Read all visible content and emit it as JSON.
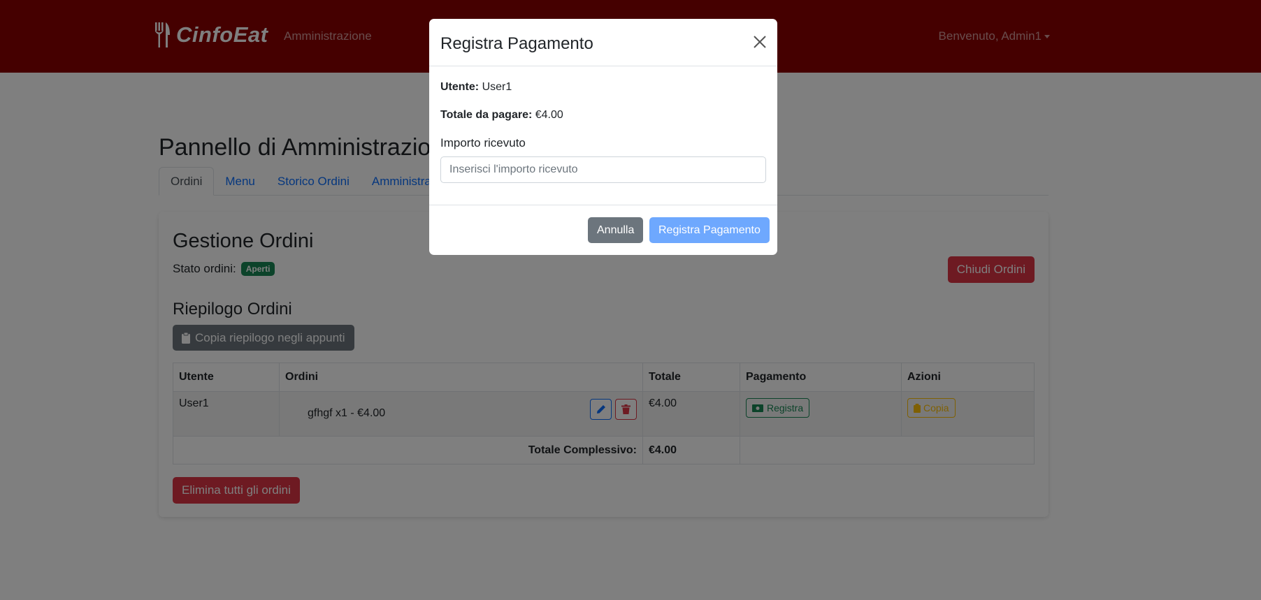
{
  "navbar": {
    "brand": "CinfoEat",
    "admin_link": "Amministrazione",
    "user_menu": "Benvenuto, Admin1"
  },
  "page": {
    "title": "Pannello di Amministrazione",
    "tabs": [
      {
        "label": "Ordini",
        "active": true
      },
      {
        "label": "Menu",
        "active": false
      },
      {
        "label": "Storico Ordini",
        "active": false
      },
      {
        "label": "Amministrat",
        "active": false
      }
    ]
  },
  "orders": {
    "title": "Gestione Ordini",
    "status_label": "Stato ordini:",
    "status_badge": "Aperti",
    "close_button": "Chiudi Ordini",
    "summary_title": "Riepilogo Ordini",
    "copy_summary_button": "Copia riepilogo negli appunti",
    "table": {
      "headers": [
        "Utente",
        "Ordini",
        "Totale",
        "Pagamento",
        "Azioni"
      ],
      "rows": [
        {
          "user": "User1",
          "order": "gfhgf x1 - €4.00",
          "total": "€4.00",
          "payment_button": "Registra",
          "action_button": "Copia"
        }
      ],
      "grand_total_label": "Totale Complessivo:",
      "grand_total_value": "€4.00"
    },
    "delete_all_button": "Elimina tutti gli ordini"
  },
  "modal": {
    "title": "Registra Pagamento",
    "user_label": "Utente:",
    "user_value": "User1",
    "total_label": "Totale da pagare:",
    "total_value": "€4.00",
    "amount_label": "Importo ricevuto",
    "amount_placeholder": "Inserisci l'importo ricevuto",
    "cancel_button": "Annulla",
    "submit_button": "Registra Pagamento"
  },
  "colors": {
    "navbar": "#8b0000",
    "primary": "#0d6efd",
    "danger": "#dc3545",
    "success": "#198754",
    "warning": "#ffc107",
    "secondary": "#6c757d"
  }
}
